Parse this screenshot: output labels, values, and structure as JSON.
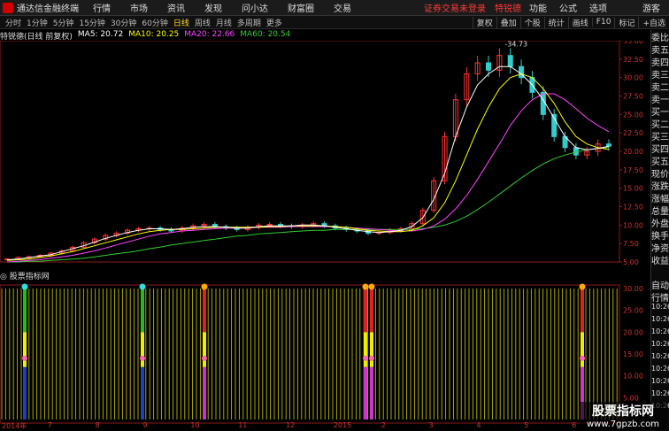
{
  "topbar": {
    "app_name": "通达信金融终端",
    "menus": [
      "行情",
      "市场",
      "资讯",
      "发现",
      "问小达",
      "财富圈",
      "交易"
    ],
    "warning": "证券交易未登录",
    "stock_label": "特锐德",
    "right_menus": [
      "功能",
      "公式",
      "选项"
    ],
    "guest": "游客"
  },
  "toolbar": {
    "periods": [
      "分时",
      "1分钟",
      "5分钟",
      "15分钟",
      "30分钟",
      "60分钟",
      "日线",
      "周线",
      "月线",
      "多周期",
      "更多"
    ],
    "selected": "日线",
    "tools": [
      "复权",
      "叠加",
      "个股",
      "统计",
      "画线",
      "F10",
      "标记",
      "+自选"
    ]
  },
  "legend": {
    "title": "特锐德(日线 前复权)",
    "ma5": "MA5: 20.72",
    "ma10": "MA10: 20.25",
    "ma20": "MA20: 22.66",
    "ma60": "MA60: 20.54",
    "colors": {
      "ma5": "#ffffff",
      "ma10": "#ffff00",
      "ma20": "#ff44ff",
      "ma60": "#33cc33"
    }
  },
  "indicator_title": "股票指标网",
  "side_items": [
    "委比",
    "卖五",
    "卖四",
    "卖三",
    "卖二",
    "卖一",
    "买一",
    "买二",
    "买三",
    "买四",
    "买五",
    "现价",
    "涨跌",
    "涨幅",
    "总量",
    "外盘",
    "换手",
    "净资",
    "收益",
    "",
    "自动",
    "行情",
    "10:26",
    "10:26",
    "10:26",
    "10:26",
    "10:26",
    "10:26",
    "10:26",
    "10:26",
    "10:26"
  ],
  "watermark": {
    "line1": "股票指标网",
    "line2": "www.7gpzb.com"
  },
  "chart_data": {
    "type": "line",
    "price_axis": {
      "ticks": [
        "35.00",
        "32.50",
        "30.00",
        "27.50",
        "25.00",
        "22.50",
        "20.00",
        "17.50",
        "15.00",
        "12.50",
        "10.00",
        "7.50",
        "5.00"
      ],
      "ylim": [
        5,
        35
      ]
    },
    "indicator_axis": {
      "ticks": [
        "30.00",
        "25.00",
        "20.00",
        "15.00",
        "10.00",
        "5.00"
      ],
      "ylim": [
        0,
        30
      ]
    },
    "annotation": "34.73",
    "x_labels": [
      "2014年",
      "7",
      "8",
      "9",
      "10",
      "11",
      "12",
      "2015",
      "2",
      "3",
      "4",
      "5",
      "6"
    ],
    "close": [
      5.4,
      5.6,
      5.7,
      5.9,
      6.2,
      6.5,
      7.0,
      7.6,
      8.1,
      8.6,
      8.9,
      9.3,
      9.5,
      9.6,
      9.4,
      9.2,
      9.6,
      9.9,
      10.1,
      9.8,
      9.6,
      9.4,
      9.7,
      10.0,
      10.1,
      9.9,
      9.8,
      10.0,
      10.2,
      9.9,
      9.6,
      9.4,
      9.2,
      8.9,
      9.0,
      9.3,
      9.5,
      10.2,
      12.0,
      16.0,
      22.0,
      27.0,
      30.5,
      32.0,
      31.0,
      33.0,
      31.5,
      30.0,
      28.0,
      25.0,
      22.0,
      20.5,
      19.5,
      20.0,
      21.0,
      20.7
    ],
    "ma5": [
      5.3,
      5.4,
      5.6,
      5.8,
      6.0,
      6.4,
      6.8,
      7.2,
      7.7,
      8.2,
      8.6,
      9.0,
      9.3,
      9.5,
      9.5,
      9.4,
      9.5,
      9.7,
      9.8,
      9.8,
      9.7,
      9.6,
      9.6,
      9.8,
      9.9,
      9.9,
      9.9,
      10.0,
      10.0,
      9.9,
      9.7,
      9.5,
      9.3,
      9.1,
      9.0,
      9.1,
      9.3,
      9.8,
      11.0,
      13.5,
      17.0,
      22.0,
      26.0,
      29.0,
      30.5,
      31.5,
      31.5,
      30.5,
      29.0,
      27.0,
      24.5,
      22.0,
      20.5,
      20.2,
      20.4,
      20.7
    ],
    "ma10": [
      5.2,
      5.3,
      5.4,
      5.6,
      5.8,
      6.1,
      6.4,
      6.8,
      7.2,
      7.6,
      8.0,
      8.4,
      8.8,
      9.1,
      9.3,
      9.4,
      9.4,
      9.5,
      9.6,
      9.7,
      9.7,
      9.7,
      9.7,
      9.7,
      9.8,
      9.8,
      9.9,
      9.9,
      9.9,
      9.9,
      9.8,
      9.7,
      9.5,
      9.3,
      9.2,
      9.1,
      9.1,
      9.3,
      9.9,
      11.0,
      13.0,
      16.0,
      19.5,
      23.0,
      26.0,
      28.5,
      30.0,
      30.5,
      30.0,
      28.5,
      26.5,
      24.0,
      22.0,
      21.0,
      20.5,
      20.25
    ],
    "ma20": [
      5.0,
      5.1,
      5.2,
      5.3,
      5.5,
      5.7,
      5.9,
      6.2,
      6.5,
      6.9,
      7.3,
      7.7,
      8.1,
      8.5,
      8.8,
      9.0,
      9.2,
      9.3,
      9.4,
      9.5,
      9.6,
      9.6,
      9.6,
      9.7,
      9.7,
      9.7,
      9.8,
      9.8,
      9.8,
      9.8,
      9.8,
      9.7,
      9.6,
      9.5,
      9.4,
      9.3,
      9.2,
      9.2,
      9.4,
      9.9,
      10.8,
      12.2,
      14.0,
      16.2,
      18.6,
      21.0,
      23.5,
      25.5,
      27.0,
      27.8,
      27.8,
      27.0,
      25.8,
      24.5,
      23.5,
      22.66
    ],
    "ma60": [
      5.0,
      5.0,
      5.1,
      5.1,
      5.2,
      5.3,
      5.4,
      5.5,
      5.7,
      5.9,
      6.1,
      6.3,
      6.5,
      6.8,
      7.0,
      7.3,
      7.5,
      7.7,
      7.9,
      8.1,
      8.3,
      8.5,
      8.6,
      8.8,
      8.9,
      9.0,
      9.1,
      9.2,
      9.3,
      9.3,
      9.4,
      9.4,
      9.4,
      9.4,
      9.4,
      9.4,
      9.4,
      9.4,
      9.5,
      9.7,
      10.0,
      10.5,
      11.2,
      12.1,
      13.1,
      14.2,
      15.3,
      16.4,
      17.4,
      18.3,
      19.0,
      19.5,
      19.9,
      20.2,
      20.4,
      20.54
    ],
    "signals": [
      {
        "x": 0.04,
        "type": "buy",
        "bottom": "#1e3fbf"
      },
      {
        "x": 0.23,
        "type": "buy",
        "bottom": "#1e3fbf"
      },
      {
        "x": 0.33,
        "type": "sell",
        "bottom": "#cc33cc"
      },
      {
        "x": 0.59,
        "type": "sell",
        "bottom": "#cc33cc"
      },
      {
        "x": 0.6,
        "type": "sell",
        "bottom": "#cc33cc"
      },
      {
        "x": 0.94,
        "type": "sell",
        "bottom": "#cc33cc"
      }
    ]
  }
}
